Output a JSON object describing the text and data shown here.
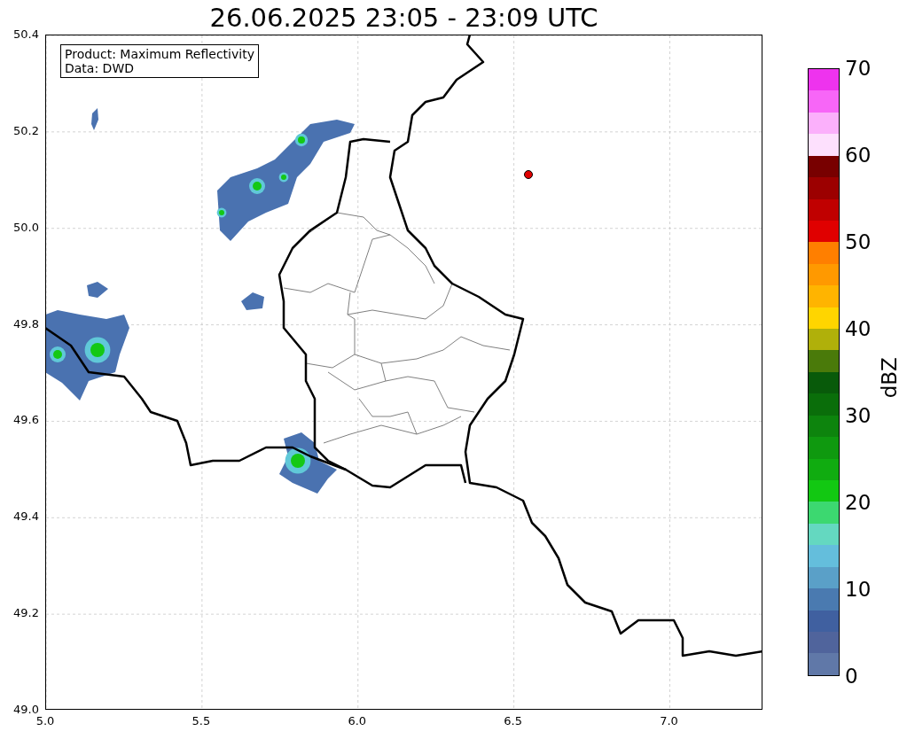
{
  "title": "26.06.2025 23:05 - 23:09 UTC",
  "info_box": {
    "lines": [
      "Product: Maximum Reflectivity",
      "Data: DWD"
    ]
  },
  "x_ticks": [
    "5.0",
    "5.5",
    "6.0",
    "6.5",
    "7.0"
  ],
  "y_ticks": [
    "50.4",
    "50.2",
    "50.0",
    "49.8",
    "49.6",
    "49.4",
    "49.2",
    "49.0"
  ],
  "colorbar": {
    "label": "dBZ",
    "ticks": [
      "70",
      "60",
      "50",
      "40",
      "30",
      "20",
      "10",
      "0"
    ],
    "segments": [
      {
        "color": "#ee33ee"
      },
      {
        "color": "#f766f7"
      },
      {
        "color": "#fbb0fb"
      },
      {
        "color": "#fde0fd"
      },
      {
        "color": "#780000"
      },
      {
        "color": "#9c0000"
      },
      {
        "color": "#c00000"
      },
      {
        "color": "#e00000"
      },
      {
        "color": "#ff7f00"
      },
      {
        "color": "#ff9900"
      },
      {
        "color": "#ffb400"
      },
      {
        "color": "#ffd500"
      },
      {
        "color": "#b0b00a"
      },
      {
        "color": "#4a7a0a"
      },
      {
        "color": "#085a0a"
      },
      {
        "color": "#0a6e0a"
      },
      {
        "color": "#0d840d"
      },
      {
        "color": "#0f990f"
      },
      {
        "color": "#10ac10"
      },
      {
        "color": "#12c812"
      },
      {
        "color": "#3cd870"
      },
      {
        "color": "#64d8c0"
      },
      {
        "color": "#64bedc"
      },
      {
        "color": "#5aa0c8"
      },
      {
        "color": "#4a7ab0"
      },
      {
        "color": "#4060a0"
      },
      {
        "color": "#50649c"
      },
      {
        "color": "#6078a8"
      }
    ]
  }
}
